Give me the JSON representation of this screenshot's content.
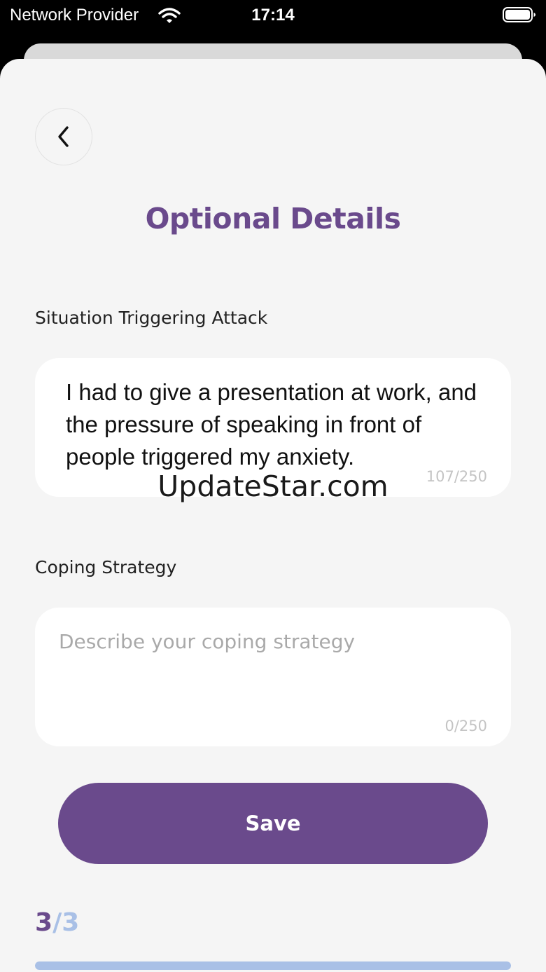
{
  "status_bar": {
    "carrier": "Network Provider",
    "time": "17:14"
  },
  "header": {
    "back_icon": "chevron-left-icon",
    "title": "Optional Details"
  },
  "situation": {
    "label": "Situation Triggering Attack",
    "value": "I had to give a presentation at work, and the pressure of speaking in front of people triggered my anxiety.",
    "count": "107/250"
  },
  "coping": {
    "label": "Coping Strategy",
    "placeholder": "Describe your coping strategy",
    "count": "0/250"
  },
  "watermark": "UpdateStar.com",
  "save_label": "Save",
  "step": {
    "current": "3",
    "separator": "/",
    "total": "3",
    "progress": 1.0
  },
  "colors": {
    "accent": "#6a4a8c",
    "progress": "#a9c0e6",
    "background": "#f5f5f5"
  }
}
